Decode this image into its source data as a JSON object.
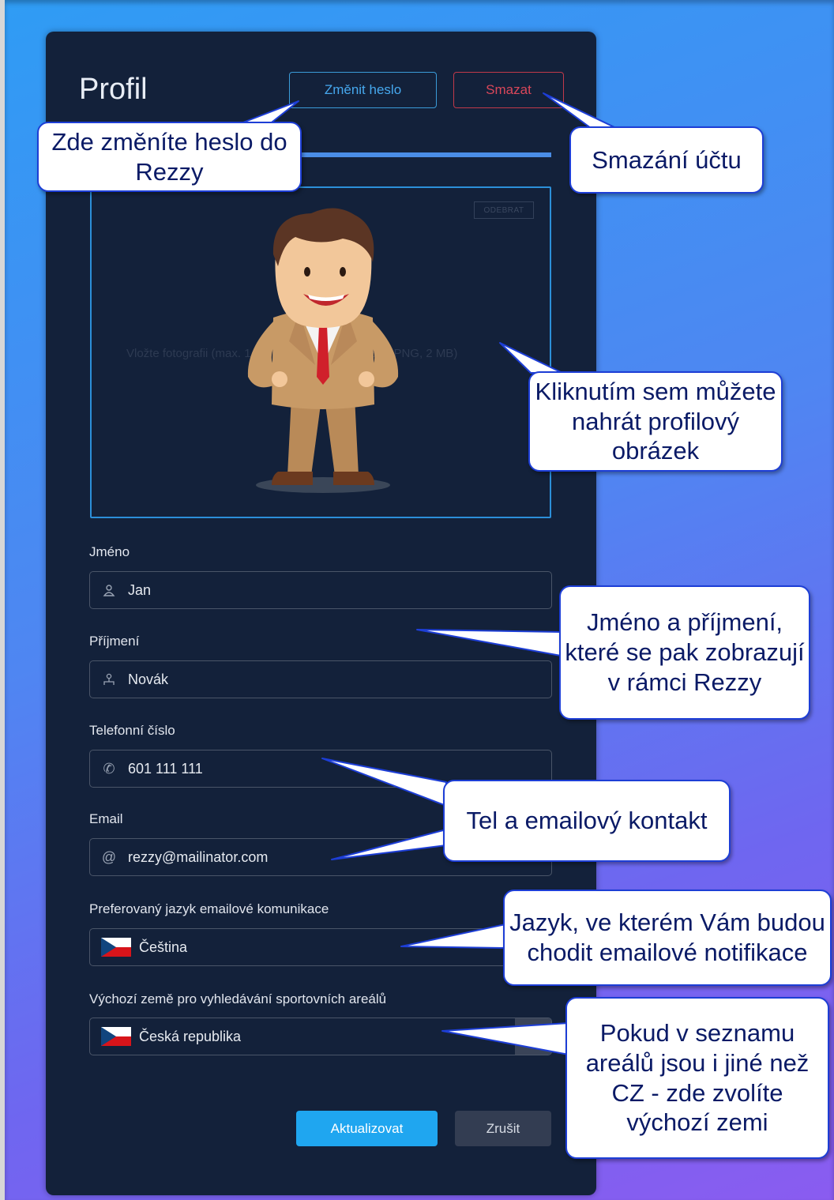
{
  "profile": {
    "title": "Profil",
    "change_password_label": "Změnit heslo",
    "delete_label": "Smazat",
    "photo": {
      "remove_label": "ODEBRAT",
      "hint": "Vložte fotografii (max. 1 MB) nebo klikněte (JPEG, PNG, 2 MB)"
    }
  },
  "form": {
    "first_name": {
      "label": "Jméno",
      "value": "Jan",
      "icon": "user-icon"
    },
    "last_name": {
      "label": "Příjmení",
      "value": "Novák",
      "icon": "users-icon"
    },
    "phone": {
      "label": "Telefonní číslo",
      "value": "601 111 111",
      "icon": "phone-icon"
    },
    "email": {
      "label": "Email",
      "value": "rezzy@mailinator.com",
      "icon": "at-icon"
    },
    "language": {
      "label": "Preferovaný jazyk emailové komunikace",
      "value": "Čeština",
      "icon": "czech-flag-icon"
    },
    "country": {
      "label": "Výchozí země pro vyhledávání sportovních areálů",
      "value": "Česká republika",
      "icon": "czech-flag-icon"
    }
  },
  "actions": {
    "update_label": "Aktualizovat",
    "cancel_label": "Zrušit"
  },
  "callouts": {
    "password": "Zde změníte heslo do Rezzy",
    "delete": "Smazání účtu",
    "photo": "Kliknutím sem můžete nahrát profilový obrázek",
    "name": "Jméno a příjmení, které se pak zobrazují v rámci Rezzy",
    "contact": "Tel a emailový kontakt",
    "language": "Jazyk, ve kterém Vám budou chodit emailové notifikace",
    "country": "Pokud v seznamu areálů jsou i jiné než CZ - zde zvolíte výchozí zemi"
  },
  "colors": {
    "panel": "#13213a",
    "accent": "#1fa6f0",
    "danger": "#d9475a",
    "callout_border": "#1d3ed6"
  }
}
